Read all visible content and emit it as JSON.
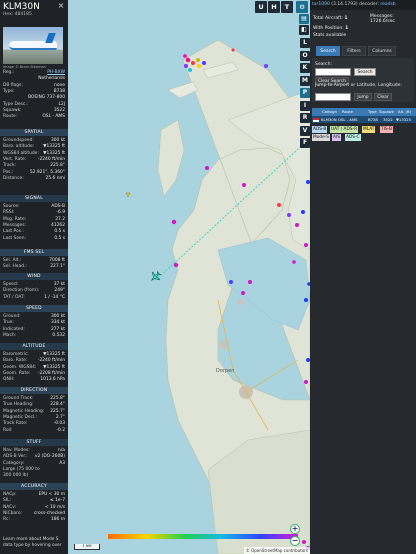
{
  "aircraft": {
    "callsign": "KLM30N",
    "hex_line": "Hex: 484185",
    "photo_credit": "Image © Bram Steeman"
  },
  "info_top": [
    {
      "k": "Reg.:",
      "v": "PH-BXW"
    },
    {
      "k": "",
      "v": "Netherlands"
    },
    {
      "k": "DB flags:",
      "v": "none"
    },
    {
      "k": "Type:",
      "v": "B738"
    },
    {
      "k": "",
      "v": "BOEING 737-800"
    },
    {
      "k": "Type Desc.:",
      "v": "L2J"
    },
    {
      "k": "Squawk:",
      "v": "3522"
    },
    {
      "k": "Route:",
      "v": "OSL - AMS"
    }
  ],
  "sections": {
    "spatial": "SPATIAL",
    "signal": "SIGNAL",
    "fms": "FMS SEL",
    "wind": "WIND",
    "speed": "SPEED",
    "altitude": "ALTITUDE",
    "direction": "DIRECTION",
    "stuff": "STUFF",
    "accuracy": "ACCURACY"
  },
  "spatial": [
    {
      "k": "Groundspeed:",
      "v": "300 kt"
    },
    {
      "k": "Baro. altitude:",
      "v": "▼13325 ft"
    },
    {
      "k": "WGS84 altitude:",
      "v": "▼13325 ft"
    },
    {
      "k": "Vert. Rate:",
      "v": "-2240 ft/min"
    },
    {
      "k": "Track:",
      "v": "225.8°"
    },
    {
      "k": "Pos.:",
      "v": "52.921°, 5.360°"
    },
    {
      "k": "Distance:",
      "v": "25.6 nmi"
    }
  ],
  "signal": [
    {
      "k": "Source:",
      "v": "ADS-B"
    },
    {
      "k": "RSSI:",
      "v": "-6.9"
    },
    {
      "k": "Msg. Rate:",
      "v": "27.2"
    },
    {
      "k": "Messages:",
      "v": "41262"
    },
    {
      "k": "Last Pos.:",
      "v": "0.5 s"
    },
    {
      "k": "Last Seen:",
      "v": "0.5 s"
    }
  ],
  "fms": [
    {
      "k": "Sel. Alt.:",
      "v": "7008 ft"
    },
    {
      "k": "Sel. Head.:",
      "v": "227.1°"
    }
  ],
  "wind": [
    {
      "k": "Speed:",
      "v": "37 kt"
    },
    {
      "k": "Direction (from):",
      "v": "249°"
    },
    {
      "k": "TAT / OAT:",
      "v": "1 / -14 °C"
    }
  ],
  "speed": [
    {
      "k": "Ground:",
      "v": "300 kt"
    },
    {
      "k": "True:",
      "v": "334 kt"
    },
    {
      "k": "Indicated:",
      "v": "277 kt"
    },
    {
      "k": "Mach:",
      "v": "0.532"
    }
  ],
  "altitude": [
    {
      "k": "Barometric:",
      "v": "▼13325 ft"
    },
    {
      "k": "Baro. Rate:",
      "v": "-2240 ft/min"
    },
    {
      "k": "Geom. WGS84:",
      "v": "▼13325 ft"
    },
    {
      "k": "Geom. Rate:",
      "v": "-2208 ft/min"
    },
    {
      "k": "QNH:",
      "v": "1013.6 hPa"
    }
  ],
  "direction": [
    {
      "k": "Ground Track:",
      "v": "225.8°"
    },
    {
      "k": "True Heading:",
      "v": "228.4°"
    },
    {
      "k": "Magnetic Heading:",
      "v": "225.7°"
    },
    {
      "k": "Magnetic Decl.:",
      "v": "2.7°"
    },
    {
      "k": "Track Rate:",
      "v": "-0.03"
    },
    {
      "k": "Roll:",
      "v": "-0.2"
    }
  ],
  "stuff": [
    {
      "k": "Nav. Modes:",
      "v": "n/a"
    },
    {
      "k": "ADS-B Ver.:",
      "v": "v2 (DO-260B)"
    },
    {
      "k": "Category:",
      "v": "A3"
    },
    {
      "k": "Large (75 000 to",
      "v": ""
    },
    {
      "k": "300 000 lb)",
      "v": ""
    }
  ],
  "accuracy": [
    {
      "k": "NACp:",
      "v": "EPU < 30 m"
    },
    {
      "k": "SIL:",
      "v": "≤ 1e-7"
    },
    {
      "k": "NACv:",
      "v": "< 10 m/s"
    },
    {
      "k": "NICbaro:",
      "v": "cross-checked"
    },
    {
      "k": "Rc:",
      "v": "186 m"
    }
  ],
  "footer": [
    "Learn more about Mode S",
    "data type by hovering over"
  ],
  "map_buttons": {
    "u": "U",
    "h": "H",
    "t": "T",
    "side": [
      "L",
      "O",
      "K",
      "M",
      "P",
      "I",
      "R",
      "V",
      "F"
    ]
  },
  "map_scale": "1 NM",
  "map_attribution": "© OpenStreetMap contributors",
  "right": {
    "header_link": "tar1090",
    "header_version": "(3.14.1793)",
    "header_decoder": "decoder:",
    "header_decoder_val": "readsb",
    "total_label": "Total Aircraft:",
    "total_value": "1",
    "messages_label": "Messages:",
    "messages_value": "1726.6/sec",
    "with_pos_label": "With Position:",
    "with_pos_value": "1",
    "stats": "Stats available",
    "tabs": [
      "Search",
      "Filters",
      "Columns"
    ],
    "search_label": "Search:",
    "search_btn": "Search",
    "clear_search_btn": "Clear Search",
    "jump_label": "Jump to Airport or Latitude, Longitude:",
    "jump_btn": "Jump",
    "clear_btn": "Clear",
    "columns": [
      "Callsign",
      "Route",
      "Type",
      "Squawk",
      "Alt. (ft)"
    ],
    "row": {
      "callsign": "KLM30N",
      "route": "OSL - AMS",
      "type": "B738",
      "squawk": "3522",
      "alt": "▼13325"
    },
    "chips": [
      {
        "label": "ADS-B",
        "color": "#b6d6f2"
      },
      {
        "label": "UAT / ADS-R",
        "color": "#c4e3a8"
      },
      {
        "label": "MLAT",
        "color": "#f1dd7e"
      },
      {
        "label": "TIS-B",
        "color": "#f6b2b2"
      },
      {
        "label": "Mode-S",
        "color": "#d9d9d9"
      },
      {
        "label": "AIS",
        "color": "#d5c2ee"
      },
      {
        "label": "ADS-C",
        "color": "#b9efe5"
      }
    ]
  },
  "colors": {
    "accent": "#3b79b4",
    "trail": "#3fd6c3",
    "section": "#2c4256"
  }
}
